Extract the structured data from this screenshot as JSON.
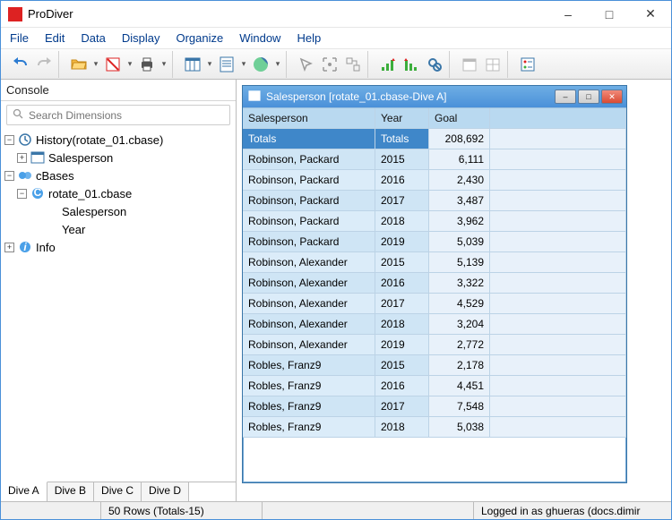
{
  "app": {
    "title": "ProDiver"
  },
  "menu": [
    "File",
    "Edit",
    "Data",
    "Display",
    "Organize",
    "Window",
    "Help"
  ],
  "console": {
    "title": "Console",
    "search_placeholder": "Search Dimensions",
    "tree": {
      "history_label": "History(rotate_01.cbase)",
      "salesperson_dim": "Salesperson",
      "cbases_label": "cBases",
      "cbase_file": "rotate_01.cbase",
      "cbase_dim_sp": "Salesperson",
      "cbase_dim_yr": "Year",
      "info_label": "Info"
    },
    "tabs": [
      "Dive A",
      "Dive B",
      "Dive C",
      "Dive D"
    ]
  },
  "child": {
    "title": "Salesperson [rotate_01.cbase-Dive A]",
    "columns": [
      "Salesperson",
      "Year",
      "Goal"
    ],
    "totals_label": "Totals",
    "totals_goal": "208,692",
    "rows": [
      [
        "Robinson, Packard",
        "2015",
        "6,111"
      ],
      [
        "Robinson, Packard",
        "2016",
        "2,430"
      ],
      [
        "Robinson, Packard",
        "2017",
        "3,487"
      ],
      [
        "Robinson, Packard",
        "2018",
        "3,962"
      ],
      [
        "Robinson, Packard",
        "2019",
        "5,039"
      ],
      [
        "Robinson, Alexander",
        "2015",
        "5,139"
      ],
      [
        "Robinson, Alexander",
        "2016",
        "3,322"
      ],
      [
        "Robinson, Alexander",
        "2017",
        "4,529"
      ],
      [
        "Robinson, Alexander",
        "2018",
        "3,204"
      ],
      [
        "Robinson, Alexander",
        "2019",
        "2,772"
      ],
      [
        "Robles,  Franz9",
        "2015",
        "2,178"
      ],
      [
        "Robles,  Franz9",
        "2016",
        "4,451"
      ],
      [
        "Robles,  Franz9",
        "2017",
        "7,548"
      ],
      [
        "Robles,  Franz9",
        "2018",
        "5,038"
      ]
    ]
  },
  "status": {
    "rows": "50 Rows (Totals-15)",
    "login": "Logged in as ghueras (docs.dimir"
  }
}
